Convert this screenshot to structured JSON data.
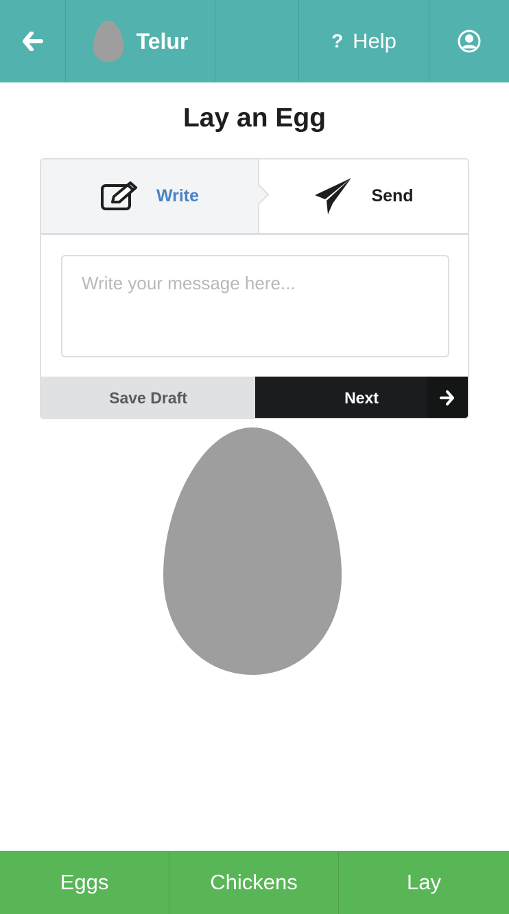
{
  "topbar": {
    "back_icon": "arrow-left-icon",
    "brand_icon": "egg-icon",
    "brand_label": "Telur",
    "help_symbol": "?",
    "help_label": "Help",
    "user_icon": "user-circle-icon"
  },
  "page": {
    "title": "Lay an Egg"
  },
  "steps": [
    {
      "label": "Write",
      "icon": "edit-icon",
      "active": true
    },
    {
      "label": "Send",
      "icon": "paper-plane-icon",
      "active": false
    }
  ],
  "message": {
    "value": "",
    "placeholder": "Write your message here..."
  },
  "actions": {
    "save_draft_label": "Save Draft",
    "next_label": "Next",
    "next_icon": "arrow-right-icon"
  },
  "egg_preview": {
    "icon": "egg-icon"
  },
  "bottom_nav": [
    {
      "label": "Eggs"
    },
    {
      "label": "Chickens"
    },
    {
      "label": "Lay"
    }
  ],
  "colors": {
    "topbar": "#52b3ae",
    "bottom_nav": "#58b657",
    "active_step_text": "#4b82c4",
    "next_button": "#1b1c1d",
    "egg": "#9e9e9e"
  }
}
